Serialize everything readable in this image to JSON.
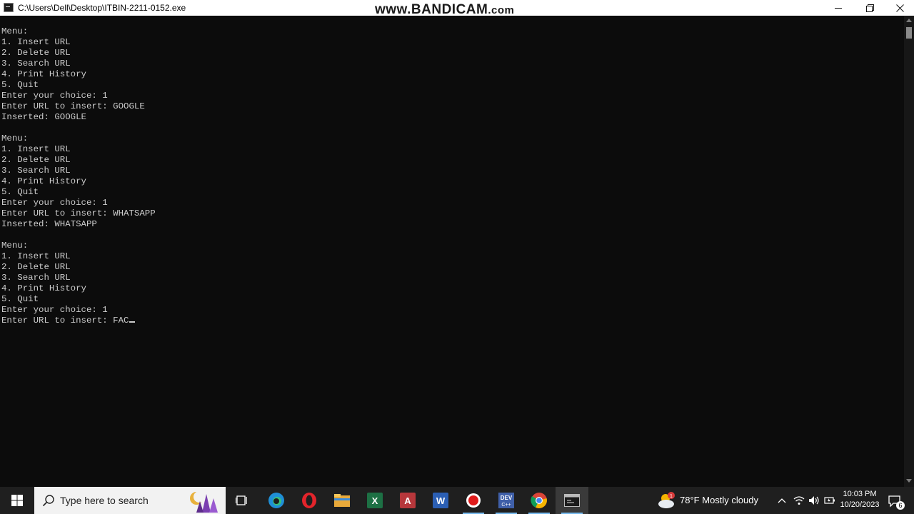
{
  "window": {
    "title": "C:\\Users\\Dell\\Desktop\\ITBIN-2211-0152.exe",
    "watermark_main": "www.BANDICAM",
    "watermark_suffix": ".com"
  },
  "console": {
    "lines": [
      "Menu:",
      "1. Insert URL",
      "2. Delete URL",
      "3. Search URL",
      "4. Print History",
      "5. Quit",
      "Enter your choice: 1",
      "Enter URL to insert: GOOGLE",
      "Inserted: GOOGLE",
      "",
      "Menu:",
      "1. Insert URL",
      "2. Delete URL",
      "3. Search URL",
      "4. Print History",
      "5. Quit",
      "Enter your choice: 1",
      "Enter URL to insert: WHATSAPP",
      "Inserted: WHATSAPP",
      "",
      "Menu:",
      "1. Insert URL",
      "2. Delete URL",
      "3. Search URL",
      "4. Print History",
      "5. Quit",
      "Enter your choice: 1"
    ],
    "current_line": "Enter URL to insert: FAC",
    "colors": {
      "background": "#0c0c0c",
      "text": "#cccccc"
    }
  },
  "taskbar": {
    "search_placeholder": "Type here to search",
    "apps": [
      {
        "name": "task-view",
        "icon": "task-view-icon"
      },
      {
        "name": "edge",
        "icon": "edge-icon"
      },
      {
        "name": "opera",
        "icon": "opera-icon"
      },
      {
        "name": "file-explorer",
        "icon": "folder-icon"
      },
      {
        "name": "excel",
        "icon": "excel-icon"
      },
      {
        "name": "access",
        "icon": "access-icon"
      },
      {
        "name": "word",
        "icon": "word-icon"
      },
      {
        "name": "bandicam",
        "icon": "record-icon"
      },
      {
        "name": "dev-cpp",
        "icon": "dev-cpp-icon"
      },
      {
        "name": "chrome",
        "icon": "chrome-icon"
      },
      {
        "name": "console-window",
        "icon": "console-icon"
      }
    ],
    "weather": {
      "temperature": "78°F",
      "condition": "Mostly cloudy",
      "alert_count": "1"
    },
    "clock": {
      "time": "10:03 PM",
      "date": "10/20/2023"
    },
    "notification_count": "6"
  }
}
